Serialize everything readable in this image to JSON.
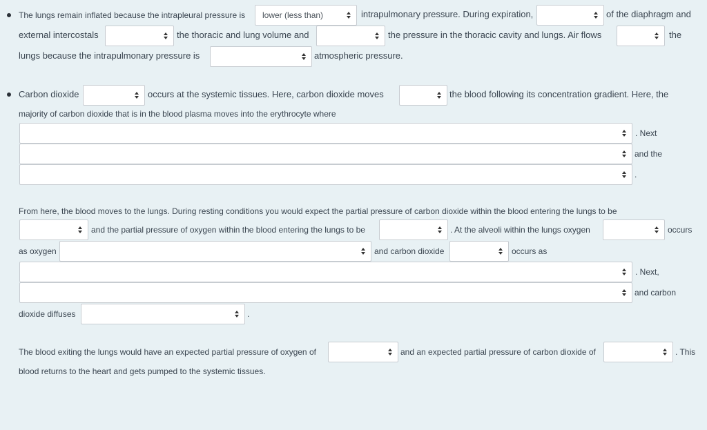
{
  "p1": {
    "a": "The lungs remain inflated because the intrapleural pressure is",
    "b": "intrapulmonary pressure.  During expiration,",
    "c": "of the diaphragm and",
    "d": "external intercostals",
    "e": "the thoracic and lung volume and",
    "f": "the pressure in the thoracic cavity and lungs.  Air flows",
    "g": "the",
    "h": "lungs because the intrapulmonary pressure is",
    "i": "atmospheric pressure."
  },
  "p2": {
    "a": "Carbon dioxide",
    "b": "occurs at the systemic tissues.  Here, carbon dioxide moves",
    "c": "the blood following its concentration gradient.  Here, the",
    "d": "majority of carbon dioxide that is in the blood plasma moves into the erythrocyte where",
    "e": ". Next",
    "f": "and the",
    "g": "."
  },
  "p3": {
    "a": "From here, the blood moves to the lungs.  During resting conditions you would expect the partial pressure of carbon dioxide within the blood entering the lungs to be",
    "b": "and the partial pressure of oxygen within the blood entering the lungs to be",
    "c": ".  At the alveoli within the lungs oxygen",
    "d": "occurs",
    "e": "as oxygen",
    "f": "and carbon dioxide",
    "g": "occurs as",
    "h": ". Next,",
    "i": "and carbon",
    "j": "dioxide diffuses",
    "k": "."
  },
  "p4": {
    "a": "The blood exiting the lungs would have an expected partial pressure of oxygen of",
    "b": "and an expected partial pressure of carbon dioxide of",
    "c": ".  This",
    "d": "blood returns to the heart and gets pumped to the systemic tissues."
  },
  "dropdowns": {
    "intrapleural_value": "lower (less than)"
  }
}
